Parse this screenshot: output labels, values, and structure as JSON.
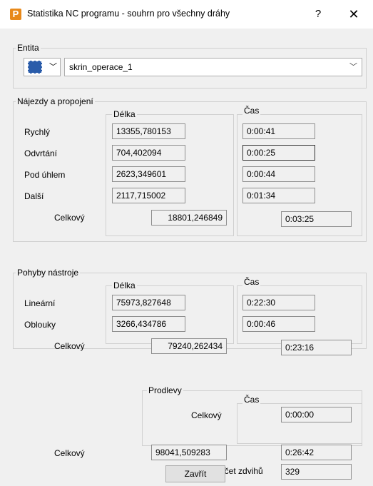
{
  "window": {
    "title": "Statistika NC programu - souhrn pro všechny dráhy",
    "help_label": "?",
    "close_label": "✕",
    "app_icon_letter": "P"
  },
  "entity": {
    "group_label": "Entita",
    "type_icon": "toolpath-icon",
    "selected": "skrin_operace_1"
  },
  "moves": {
    "group_label": "Nájezdy a propojení",
    "length_header": "Délka",
    "time_header": "Čas",
    "rows": [
      {
        "label": "Rychlý",
        "length": "13355,780153",
        "time": "0:00:41"
      },
      {
        "label": "Odvrtání",
        "length": "704,402094",
        "time": "0:00:25"
      },
      {
        "label": "Pod úhlem",
        "length": "2623,349601",
        "time": "0:00:44"
      },
      {
        "label": "Další",
        "length": "2117,715002",
        "time": "0:01:34"
      }
    ],
    "total_label": "Celkový",
    "total_length": "18801,246849",
    "total_time": "0:03:25"
  },
  "tool": {
    "group_label": "Pohyby nástroje",
    "length_header": "Délka",
    "time_header": "Čas",
    "rows": [
      {
        "label": "Lineární",
        "length": "75973,827648",
        "time": "0:22:30"
      },
      {
        "label": "Oblouky",
        "length": "3266,434786",
        "time": "0:00:46"
      }
    ],
    "total_label": "Celkový",
    "total_length": "79240,262434",
    "total_time": "0:23:16"
  },
  "dwell": {
    "group_label": "Prodlevy",
    "time_header": "Čas",
    "total_label": "Celkový",
    "total_time": "0:00:00"
  },
  "summary": {
    "total_label": "Celkový",
    "total_length": "98041,509283",
    "total_time": "0:26:42",
    "lifts_label": "Počet zdvihů",
    "lifts_value": "329"
  },
  "close_button": "Zavřít"
}
